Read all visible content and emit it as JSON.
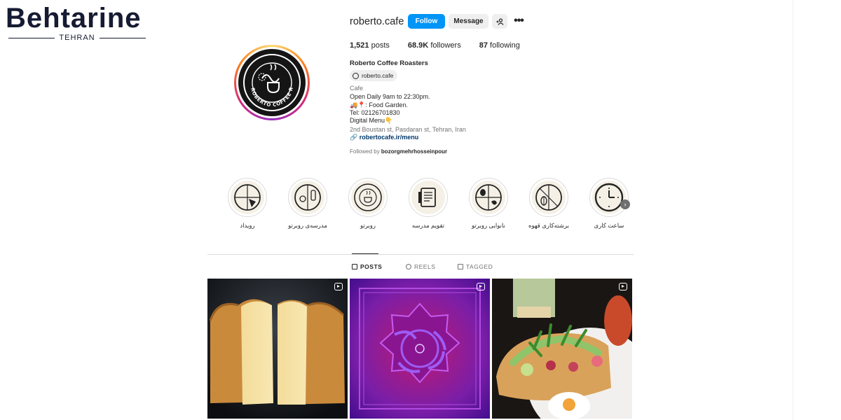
{
  "watermark": {
    "brand": "Behtarine",
    "city": "TEHRAN"
  },
  "header": {
    "username": "roberto.cafe",
    "follow_label": "Follow",
    "message_label": "Message",
    "add_user_icon": "person-plus-icon",
    "more_icon": "more-icon",
    "more_glyph": "•••",
    "stats": [
      {
        "value": "1,521",
        "label": "posts"
      },
      {
        "value": "68.9K",
        "label": "followers"
      },
      {
        "value": "87",
        "label": "following"
      }
    ],
    "display_name": "Roberto Coffee Roasters",
    "threads_handle": "roberto.cafe",
    "category": "Cafe",
    "bio_lines": [
      "Open Daily 9am to 22:30pm.",
      "🚚📍: Food Garden.",
      "Tel: 02126701830",
      "Digital Menu👇"
    ],
    "address": "2nd Boustan st, Pasdaran st, Tehran, Iran",
    "link": "robertocafe.ir/menu",
    "followed_by_prefix": "Followed by",
    "followed_by_user": "bozorgmehrhosseinpour",
    "avatar_text": "ROBERTO COFFEE ROASTERS"
  },
  "highlights": [
    {
      "label": "رویداد"
    },
    {
      "label": "مدرسه‌ی روبرتو"
    },
    {
      "label": "روبرتو"
    },
    {
      "label": "تقویم مدرسه"
    },
    {
      "label": "نانوایی روبرتو"
    },
    {
      "label": "برشته‌کاری قهوه"
    },
    {
      "label": "ساعت کاری"
    }
  ],
  "tabs": [
    {
      "label": "POSTS",
      "active": true
    },
    {
      "label": "REELS",
      "active": false
    },
    {
      "label": "TAGGED",
      "active": false
    }
  ],
  "posts": [
    {
      "subject": "bread-loaf",
      "is_reel": true
    },
    {
      "subject": "purple-pattern",
      "is_reel": true
    },
    {
      "subject": "toast-plate",
      "is_reel": true
    }
  ],
  "colors": {
    "accent": "#0095f6",
    "text": "#262626",
    "muted": "#737373",
    "link": "#00376b",
    "button_bg": "#efefef"
  }
}
